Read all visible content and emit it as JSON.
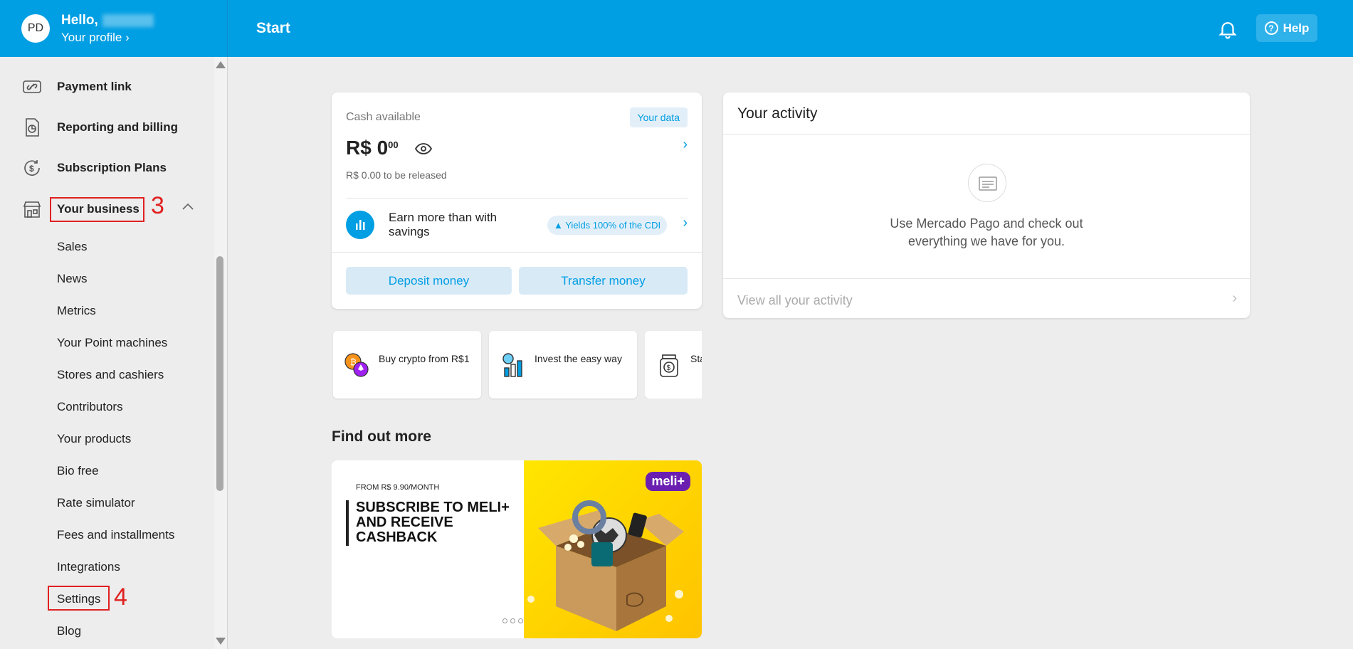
{
  "header": {
    "avatar_initials": "PD",
    "hello": "Hello,",
    "your_profile": "Your profile",
    "page_title": "Start",
    "help_label": "Help",
    "accent_color": "#009ee3"
  },
  "sidebar": {
    "items": [
      {
        "label": "Payment link",
        "icon": "payment-link-icon"
      },
      {
        "label": "Reporting and billing",
        "icon": "reporting-icon"
      },
      {
        "label": "Subscription Plans",
        "icon": "subscription-icon"
      },
      {
        "label": "Your business",
        "icon": "store-icon"
      }
    ],
    "sub_items": [
      "Sales",
      "News",
      "Metrics",
      "Your Point machines",
      "Stores and cashiers",
      "Contributors",
      "Your products",
      "Bio free",
      "Rate simulator",
      "Fees and installments",
      "Integrations",
      "Settings",
      "Blog"
    ],
    "step_3": "3",
    "step_4": "4"
  },
  "cash": {
    "label": "Cash available",
    "your_data": "Your data",
    "currency": "R$ 0",
    "cents": "00",
    "released": "R$ 0.00 to be released",
    "savings_text": "Earn more than with savings",
    "yield_badge": "▲ Yields 100% of the CDI",
    "deposit": "Deposit money",
    "transfer": "Transfer money"
  },
  "shortcuts": [
    {
      "label": "Buy crypto from R$1",
      "icon": "crypto-icon"
    },
    {
      "label": "Invest the easy way",
      "icon": "invest-icon"
    },
    {
      "label": "Sta no",
      "icon": "money-jar-icon"
    }
  ],
  "find_more": {
    "title": "Find out more",
    "banner_from": "FROM R$ 9.90/MONTH",
    "banner_text": "SUBSCRIBE TO MELI+ AND RECEIVE CASHBACK",
    "meli_badge": "meli+"
  },
  "activity": {
    "title": "Your activity",
    "message": "Use Mercado Pago and check out everything we have for you.",
    "view_all": "View all your activity"
  }
}
